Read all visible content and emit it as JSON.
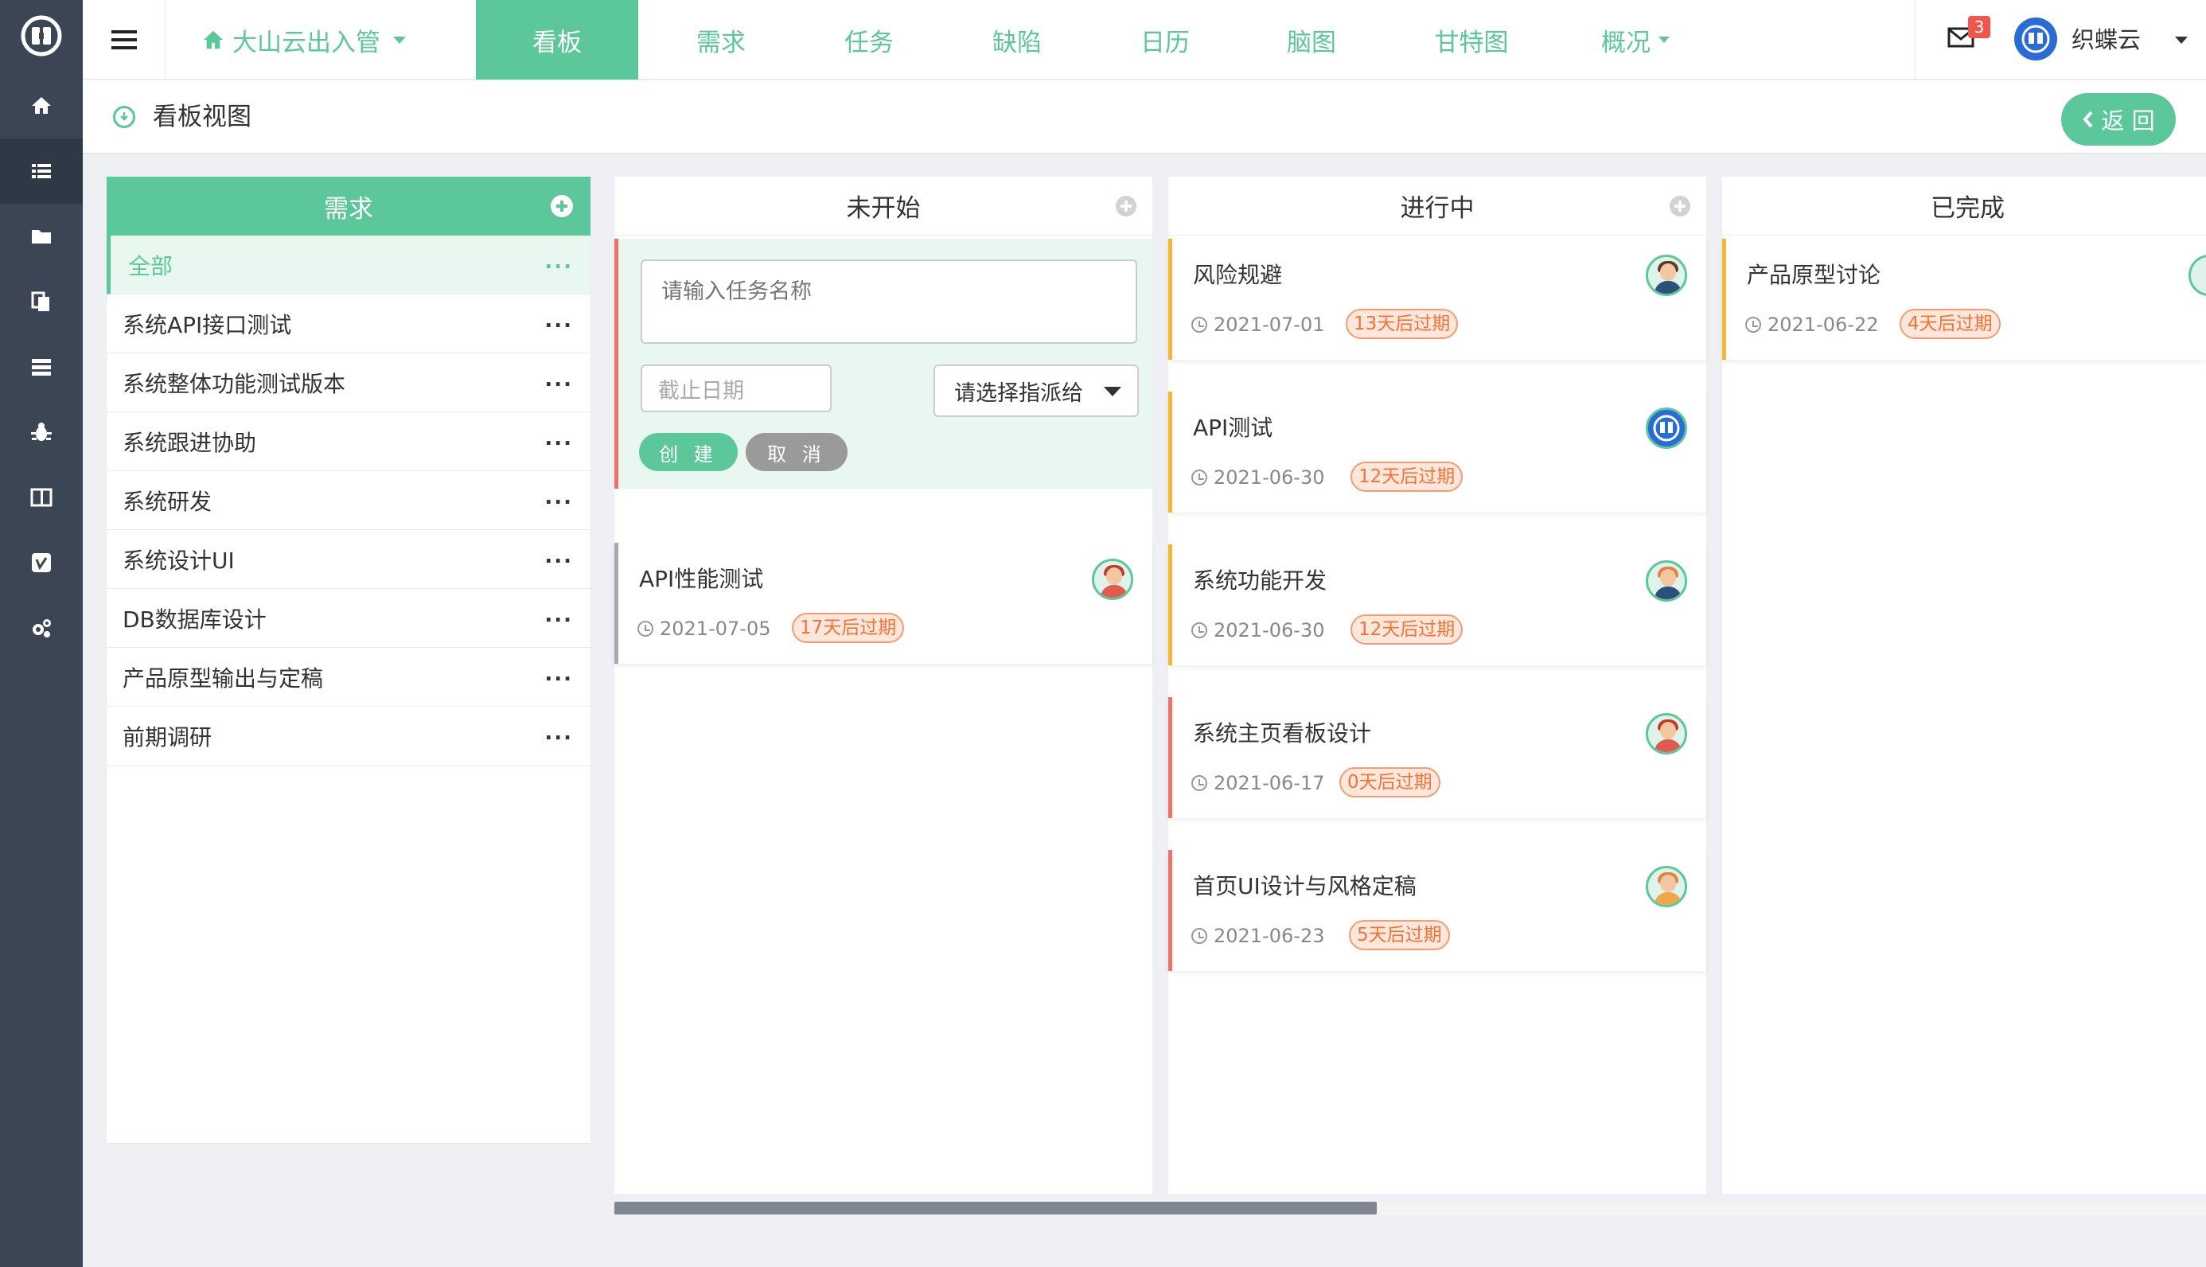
{
  "topbar": {
    "project": "大山云出入管",
    "tabs": [
      {
        "label": "看板",
        "active": true
      },
      {
        "label": "需求"
      },
      {
        "label": "任务"
      },
      {
        "label": "缺陷"
      },
      {
        "label": "日历"
      },
      {
        "label": "脑图"
      },
      {
        "label": "甘特图"
      },
      {
        "label": "概况",
        "dropdown": true
      }
    ],
    "mail_count": "3",
    "user_name": "织蝶云"
  },
  "subbar": {
    "title": "看板视图",
    "back_label": "返 回"
  },
  "requirements": {
    "title": "需求",
    "items": [
      {
        "label": "全部",
        "active": true
      },
      {
        "label": "系统API接口测试"
      },
      {
        "label": "系统整体功能测试版本"
      },
      {
        "label": "系统跟进协助"
      },
      {
        "label": "系统研发"
      },
      {
        "label": "系统设计UI"
      },
      {
        "label": "DB数据库设计"
      },
      {
        "label": "产品原型输出与定稿"
      },
      {
        "label": "前期调研"
      }
    ],
    "more": "..."
  },
  "columns": [
    {
      "title": "未开始",
      "form": {
        "task_placeholder": "请输入任务名称",
        "date_placeholder": "截止日期",
        "assignee": "请选择指派给",
        "create_label": "创 建",
        "cancel_label": "取 消"
      },
      "cards": [
        {
          "title": "API性能测试",
          "date": "2021-07-05",
          "badge": "17天后过期"
        }
      ]
    },
    {
      "title": "进行中",
      "cards": [
        {
          "title": "风险规避",
          "date": "2021-07-01",
          "badge": "13天后过期"
        },
        {
          "title": "API测试",
          "date": "2021-06-30",
          "badge": "12天后过期"
        },
        {
          "title": "系统功能开发",
          "date": "2021-06-30",
          "badge": "12天后过期"
        },
        {
          "title": "系统主页看板设计",
          "date": "2021-06-17",
          "badge": "0天后过期"
        },
        {
          "title": "首页UI设计与风格定稿",
          "date": "2021-06-23",
          "badge": "5天后过期"
        }
      ]
    },
    {
      "title": "已完成",
      "cards": [
        {
          "title": "产品原型讨论",
          "date": "2021-06-22",
          "badge": "4天后过期"
        }
      ]
    }
  ],
  "colors": {
    "accent": "#5cc79a",
    "sidebar": "#3b4553",
    "warning_stripe": "#f5b731",
    "danger_stripe": "#f07266",
    "badge_text": "#f0743a"
  }
}
